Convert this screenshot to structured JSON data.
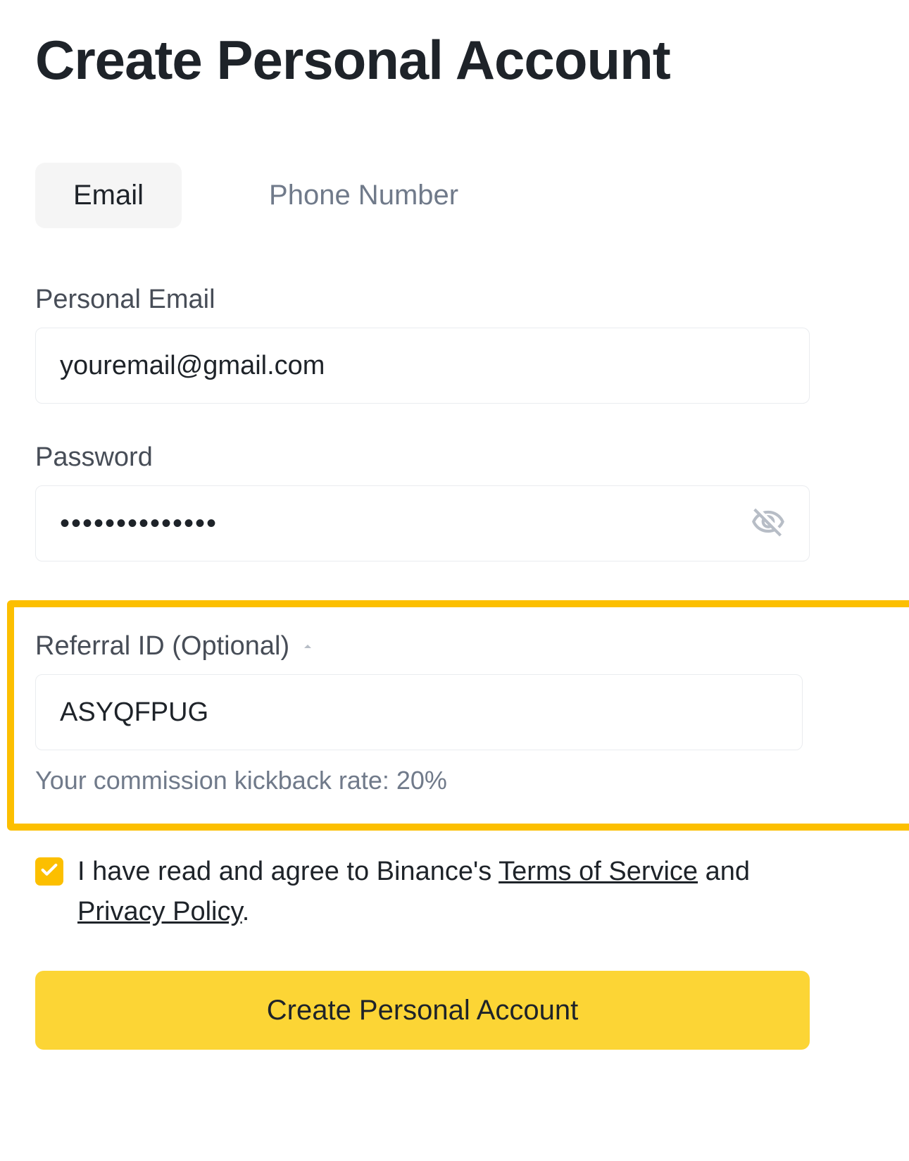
{
  "title": "Create Personal Account",
  "tabs": {
    "email": "Email",
    "phone": "Phone Number"
  },
  "email": {
    "label": "Personal Email",
    "value": "youremail@gmail.com"
  },
  "password": {
    "label": "Password",
    "value": "••••••••••••••"
  },
  "referral": {
    "label": "Referral ID (Optional)",
    "value": "ASYQFPUG",
    "helper": "Your commission kickback rate: 20%"
  },
  "agree": {
    "prefix": "I have read and agree to Binance's ",
    "terms": "Terms of Service",
    "middle": " and ",
    "privacy": "Privacy Policy",
    "suffix": "."
  },
  "submit": {
    "label": "Create Personal Account"
  },
  "icons": {
    "eye_off": "eye-off-icon",
    "caret_up": "caret-up-icon",
    "check": "check-icon"
  }
}
